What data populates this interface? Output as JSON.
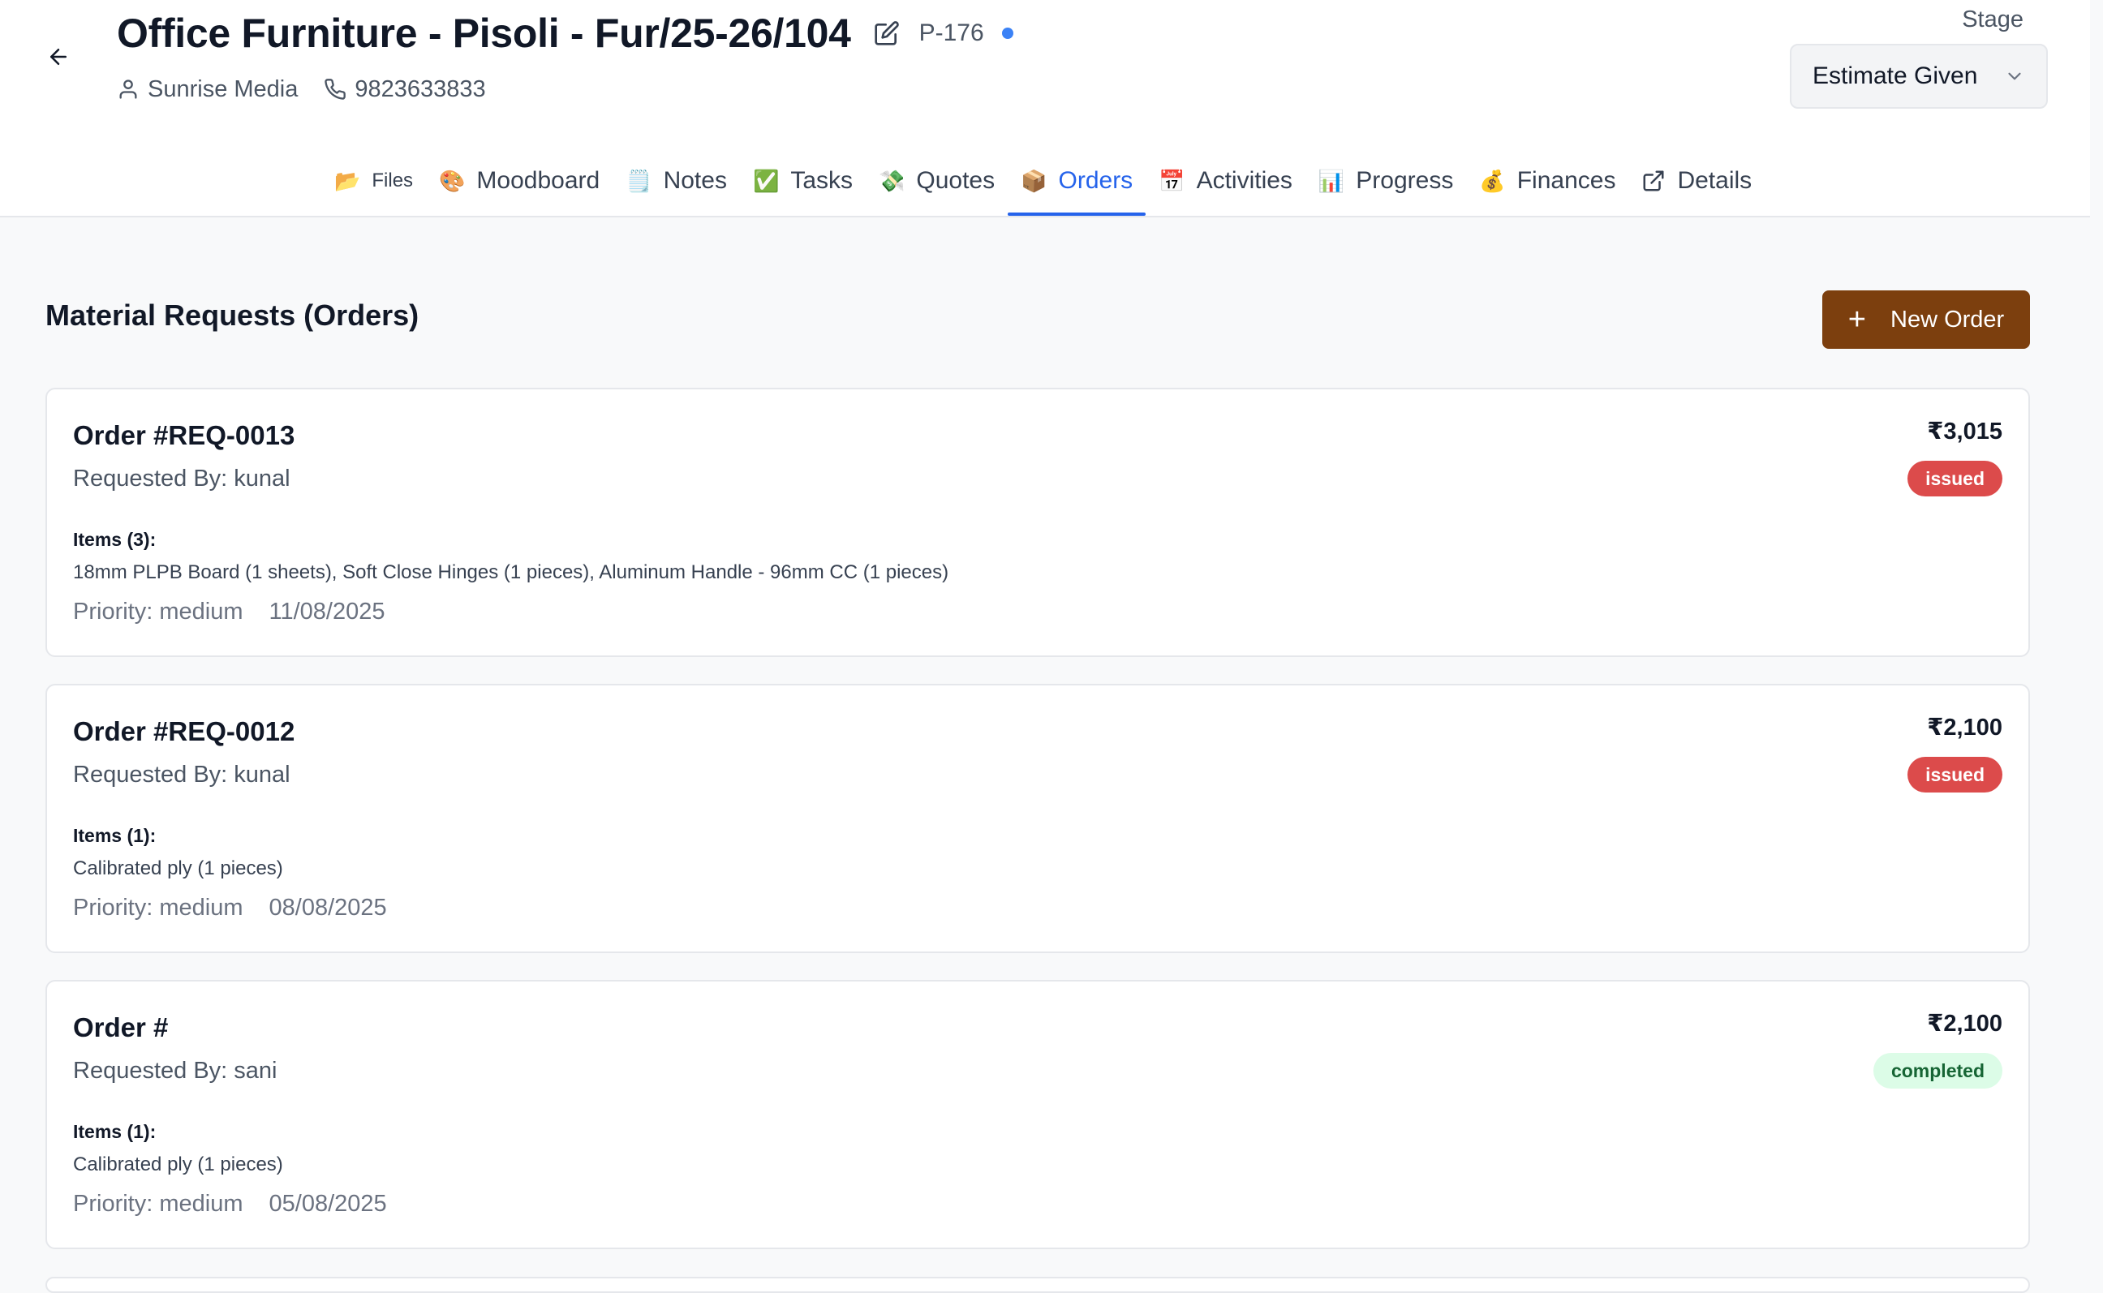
{
  "header": {
    "title": "Office Furniture - Pisoli - Fur/25-26/104",
    "project_code": "P-176",
    "client": "Sunrise Media",
    "phone": "9823633833",
    "stage_label": "Stage",
    "stage_value": "Estimate Given"
  },
  "tabs": [
    {
      "icon": "📂",
      "label": "Files"
    },
    {
      "icon": "🎨",
      "label": "Moodboard"
    },
    {
      "icon": "🗒️",
      "label": "Notes"
    },
    {
      "icon": "✅",
      "label": "Tasks"
    },
    {
      "icon": "💸",
      "label": "Quotes"
    },
    {
      "icon": "📦",
      "label": "Orders"
    },
    {
      "icon": "📅",
      "label": "Activities"
    },
    {
      "icon": "📊",
      "label": "Progress"
    },
    {
      "icon": "💰",
      "label": "Finances"
    },
    {
      "icon": "external-link-icon",
      "label": "Details"
    }
  ],
  "main": {
    "section_title": "Material Requests (Orders)",
    "new_order_label": "New Order",
    "orders": [
      {
        "title": "Order #REQ-0013",
        "requested_by": "Requested By: kunal",
        "items_label": "Items (3):",
        "items": "18mm PLPB Board (1 sheets), Soft Close Hinges (1 pieces), Aluminum Handle - 96mm CC (1 pieces)",
        "priority": "Priority: medium",
        "date": "11/08/2025",
        "amount": "₹3,015",
        "status": "issued"
      },
      {
        "title": "Order #REQ-0012",
        "requested_by": "Requested By: kunal",
        "items_label": "Items (1):",
        "items": "Calibrated ply (1 pieces)",
        "priority": "Priority: medium",
        "date": "08/08/2025",
        "amount": "₹2,100",
        "status": "issued"
      },
      {
        "title": "Order #",
        "requested_by": "Requested By: sani",
        "items_label": "Items (1):",
        "items": "Calibrated ply (1 pieces)",
        "priority": "Priority: medium",
        "date": "05/08/2025",
        "amount": "₹2,100",
        "status": "completed"
      }
    ]
  },
  "colors": {
    "accent": "#2563eb",
    "brand_button": "#7c3f0e",
    "issued": "#dc4b4b",
    "completed_bg": "#dcfce7",
    "completed_text": "#166534"
  }
}
